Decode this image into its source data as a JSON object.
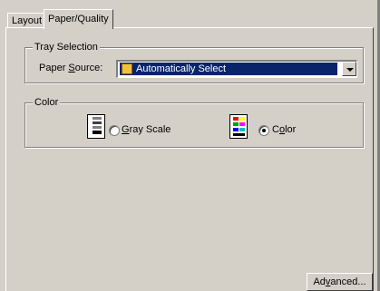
{
  "tabs": [
    {
      "label": "Layout",
      "active": false
    },
    {
      "label": "Paper/Quality",
      "active": true
    }
  ],
  "tray_selection": {
    "group_label": "Tray Selection",
    "paper_source_label_pre": "Paper ",
    "paper_source_label_u": "S",
    "paper_source_label_post": "ource:",
    "paper_source_value": "Automatically Select"
  },
  "color_group": {
    "group_label": "Color",
    "gray_label_u": "G",
    "gray_label_post": "ray Scale",
    "color_label_pre": "C",
    "color_label_u": "o",
    "color_label_post": "lor",
    "selected": "Color"
  },
  "buttons": {
    "advanced_pre": "Ad",
    "advanced_u": "v",
    "advanced_post": "anced..."
  },
  "colors": {
    "dialog_bg": "#d4d0c8",
    "selection_bg": "#0a246a"
  }
}
